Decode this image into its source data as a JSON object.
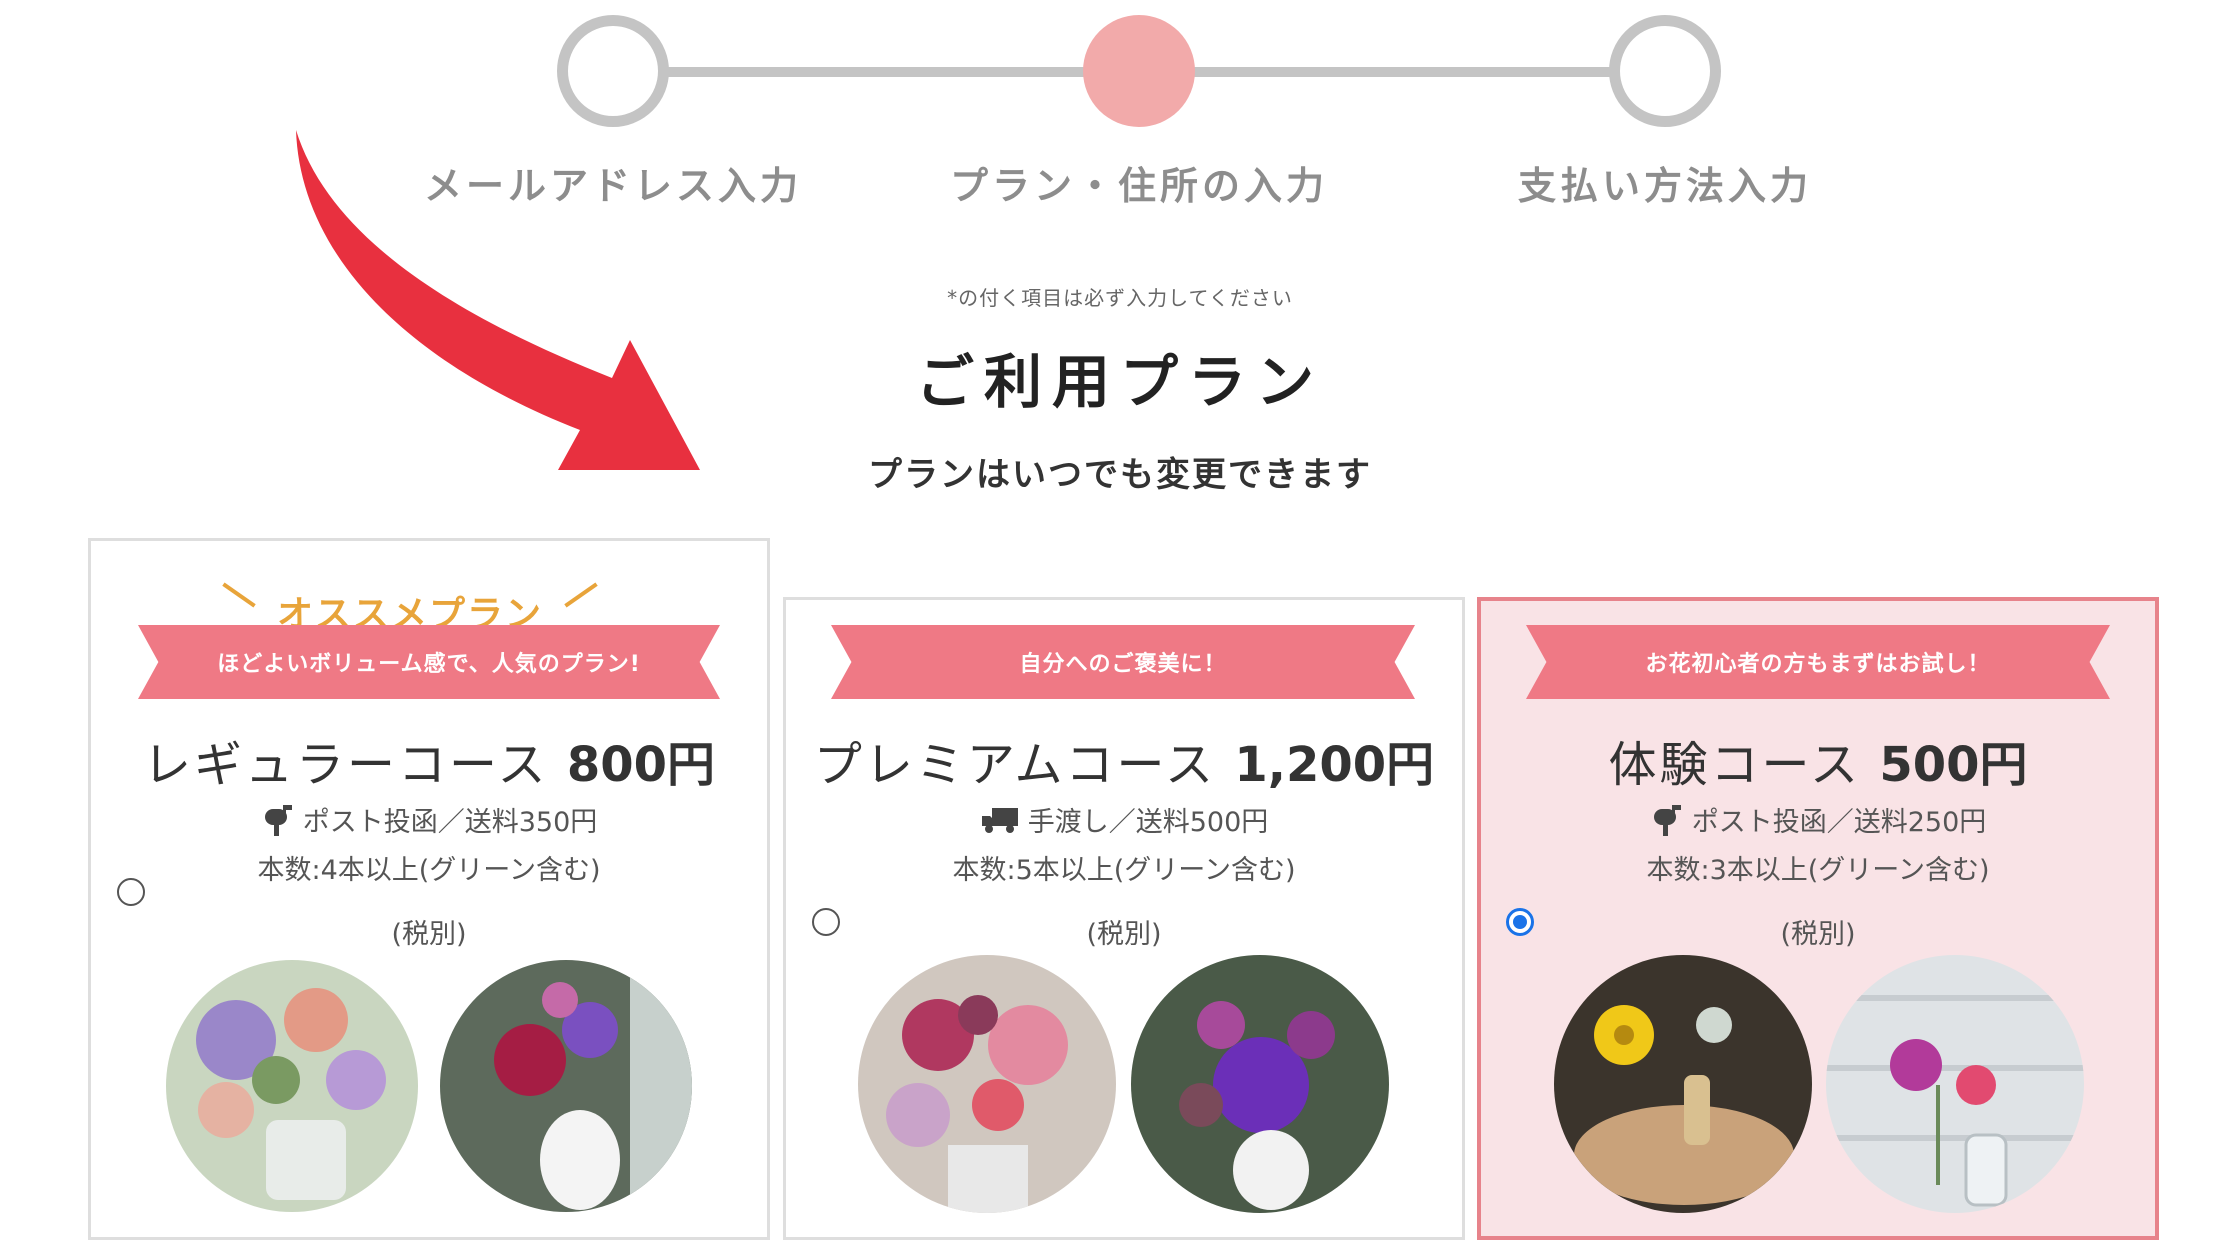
{
  "stepper": {
    "steps": [
      {
        "label": "メールアドレス入力",
        "state": "pending"
      },
      {
        "label": "プラン・住所の入力",
        "state": "active"
      },
      {
        "label": "支払い方法入力",
        "state": "pending"
      }
    ]
  },
  "form": {
    "required_note": "*の付く項目は必ず入力してください",
    "title": "ご利用プラン",
    "subtitle": "プランはいつでも変更できます"
  },
  "plans": [
    {
      "recommend_label": "オススメプラン",
      "ribbon": "ほどよいボリューム感で、人気のプラン!",
      "name": "レギュラーコース",
      "price": "800円",
      "delivery": "ポスト投函／送料350円",
      "delivery_icon": "mailbox-icon",
      "stems": "本数:4本以上(グリーン含む)",
      "tax": "(税別)",
      "selected": false
    },
    {
      "ribbon": "自分へのご褒美に！",
      "name": "プレミアムコース",
      "price": "1,200円",
      "delivery": "手渡し／送料500円",
      "delivery_icon": "truck-icon",
      "stems": "本数:5本以上(グリーン含む)",
      "tax": "(税別)",
      "selected": false
    },
    {
      "ribbon": "お花初心者の方もまずはお試し！",
      "name": "体験コース",
      "price": "500円",
      "delivery": "ポスト投函／送料250円",
      "delivery_icon": "mailbox-icon",
      "stems": "本数:3本以上(グリーン含む)",
      "tax": "(税別)",
      "selected": true
    }
  ],
  "colors": {
    "accent_pink": "#ef7985",
    "selected_bg": "#f9e3e6",
    "step_active": "#f2aaaa",
    "recommend": "#e8a43a",
    "arrow": "#e8303f",
    "radio_checked": "#1a73e8"
  }
}
